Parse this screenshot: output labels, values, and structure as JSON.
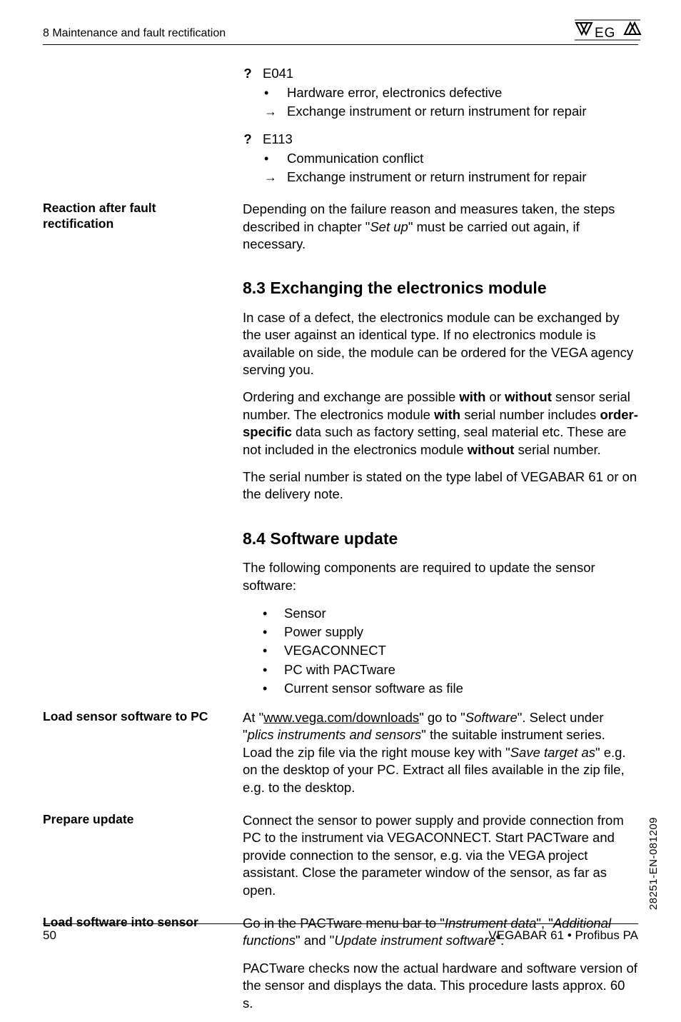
{
  "running_head": "8  Maintenance and fault rectification",
  "faults": [
    {
      "code": "E041",
      "items": [
        {
          "marker": "dot",
          "text": "Hardware error, electronics defective"
        },
        {
          "marker": "arrow",
          "text": "Exchange instrument or return instrument for repair"
        }
      ]
    },
    {
      "code": "E113",
      "items": [
        {
          "marker": "dot",
          "text": "Communication conflict"
        },
        {
          "marker": "arrow",
          "text": "Exchange instrument or return instrument for repair"
        }
      ]
    }
  ],
  "reaction": {
    "label": "Reaction after fault rectification",
    "text_pre": "Depending on the failure reason and measures taken, the steps described in chapter \"",
    "text_italic": "Set up",
    "text_post": "\" must be carried out again, if necessary."
  },
  "sec83": {
    "heading": "8.3  Exchanging the electronics module",
    "p1": "In case of a defect, the electronics module can be exchanged by the user against an identical type. If no electronics module is available on side, the module can be ordered for the VEGA agency serving you.",
    "p2_a": "Ordering and exchange are possible ",
    "p2_b1": "with",
    "p2_c": " or ",
    "p2_b2": "without",
    "p2_d": " sensor serial number. The electronics module ",
    "p2_b3": "with",
    "p2_e": " serial number includes ",
    "p2_b4": "order-specific",
    "p2_f": " data such as factory setting, seal material etc. These are not included in the electronics module ",
    "p2_b5": "without",
    "p2_g": " serial number.",
    "p3": "The serial number is stated on the type label of VEGABAR 61 or on the delivery note."
  },
  "sec84": {
    "heading": "8.4  Software update",
    "intro": "The following components are required to update the sensor software:",
    "bullets": [
      "Sensor",
      "Power supply",
      "VEGACONNECT",
      "PC with PACTware",
      "Current sensor software as file"
    ]
  },
  "load_pc": {
    "label": "Load sensor software to PC",
    "t1": "At \"",
    "link": "www.vega.com/downloads",
    "t2": "\" go to \"",
    "i1": "Software",
    "t3": "\". Select under \"",
    "i2": "plics instruments and sensors",
    "t4": "\" the suitable instrument series. Load the zip file via the right mouse key with \"",
    "i3": "Save target as",
    "t5": "\" e.g. on the desktop of your PC. Extract all files available in the zip file, e.g. to the desktop."
  },
  "prepare": {
    "label": "Prepare update",
    "text": "Connect the sensor to power supply and provide connection from PC to the instrument via VEGACONNECT. Start PACTware and provide connection to the sensor, e.g. via the VEGA project assistant. Close the parameter window of the sensor, as far as open."
  },
  "load_sensor": {
    "label": "Load software into sensor",
    "t1": "Go in the PACTware menu bar to \"",
    "i1": "Instrument data",
    "t2": "\", \"",
    "i2": "Additional functions",
    "t3": "\" and \"",
    "i3": "Update instrument software",
    "t4": "\".",
    "p2": "PACTware checks now the actual hardware and software version of the sensor and displays the data. This procedure lasts approx. 60 s."
  },
  "footer": {
    "page": "50",
    "doc": "VEGABAR 61 • Profibus PA"
  },
  "side_code": "28251-EN-081209"
}
